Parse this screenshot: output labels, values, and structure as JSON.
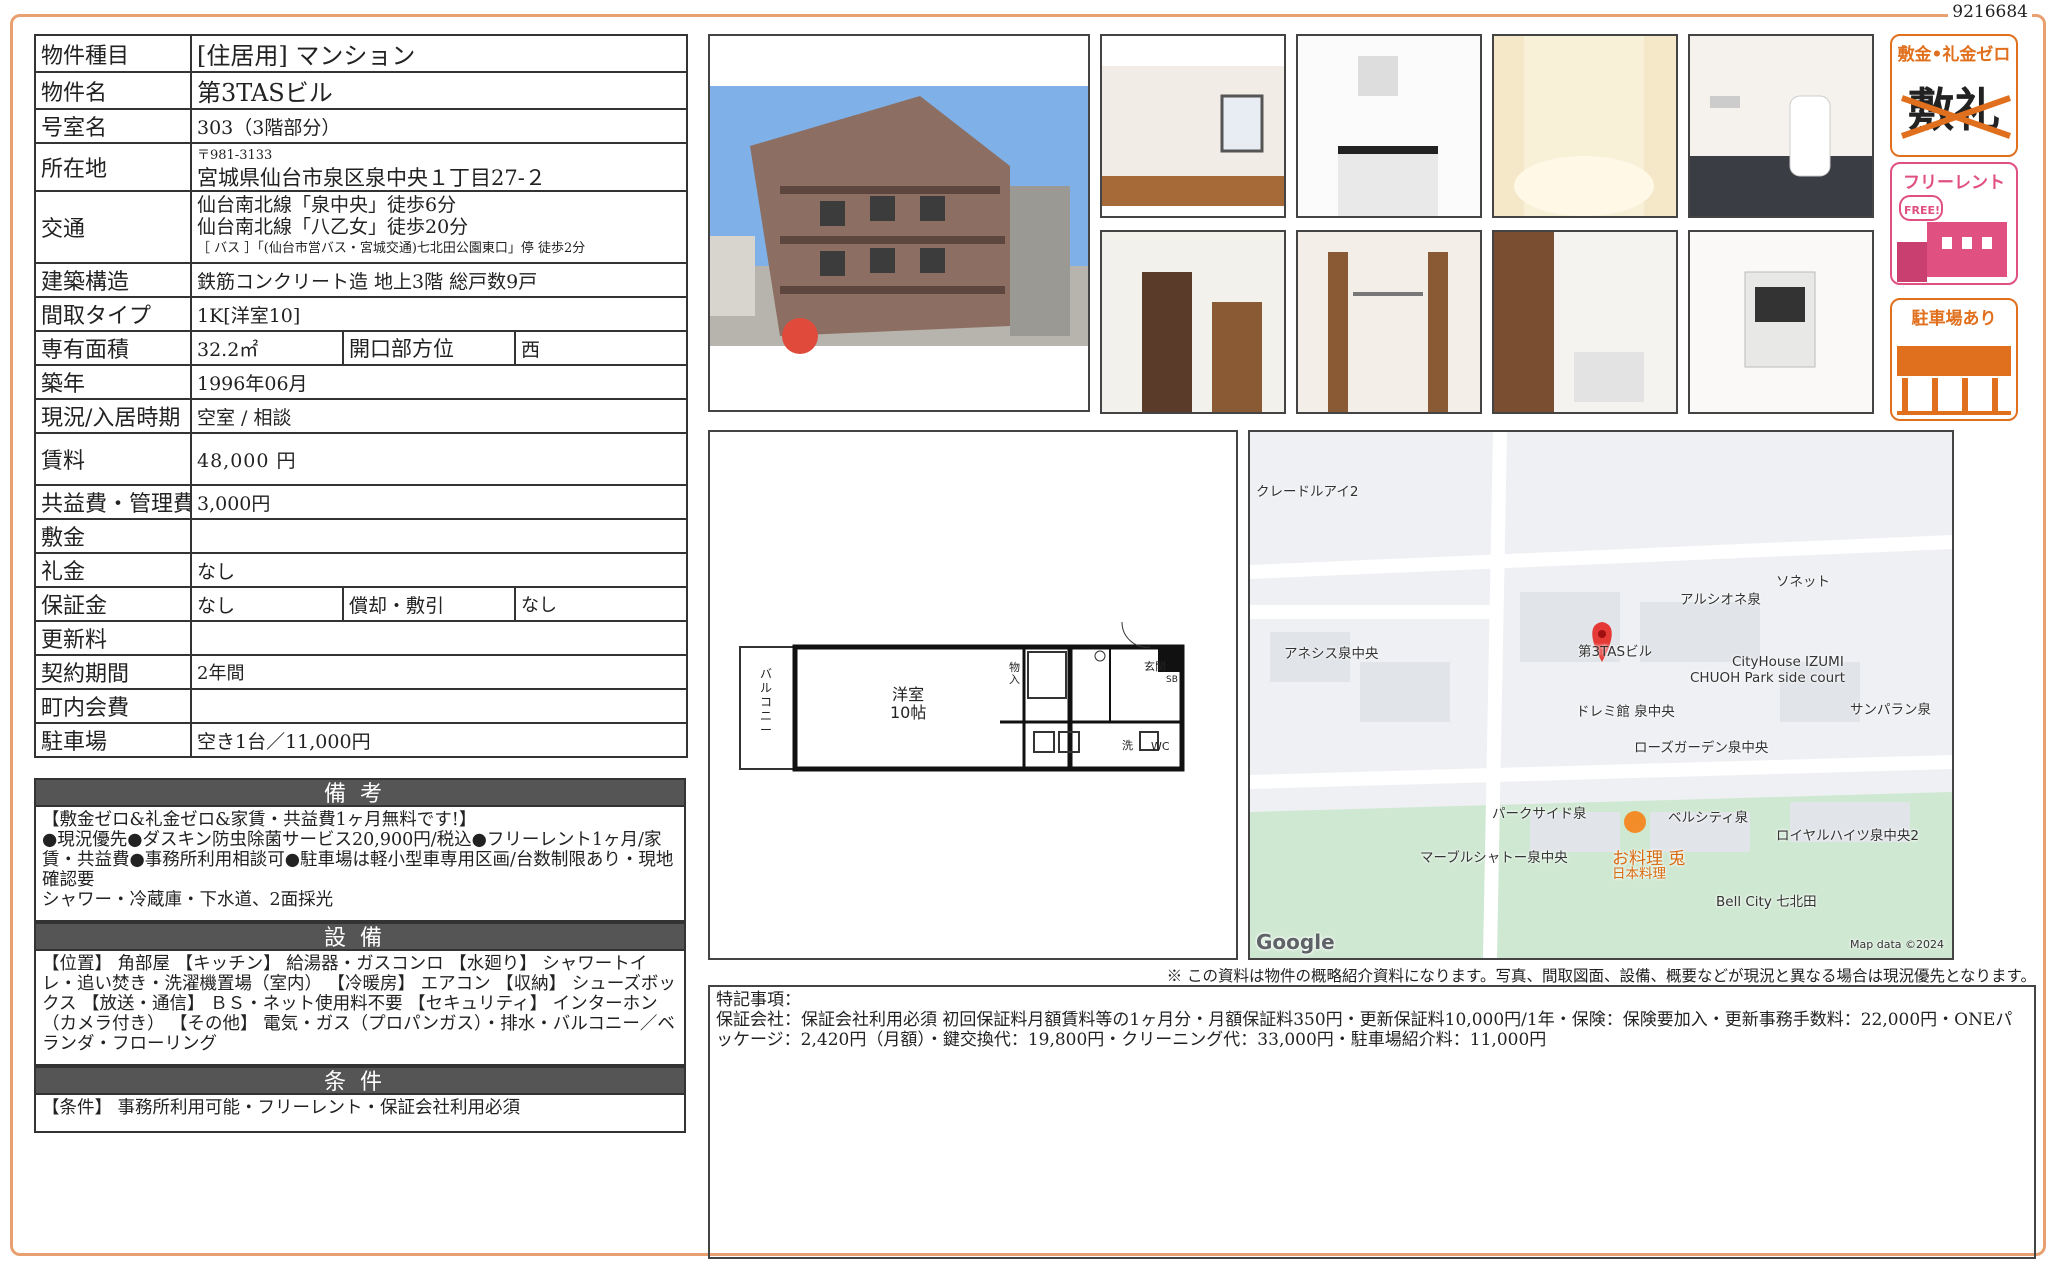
{
  "doc_id": "9216684",
  "info": {
    "type_label": "物件種目",
    "type_value": "[住居用]  マンション",
    "name_label": "物件名",
    "name_value": "第3TASビル",
    "room_label": "号室名",
    "room_value": "303（3階部分）",
    "address_label": "所在地",
    "postal": "〒981-3133",
    "address": "宮城県仙台市泉区泉中央１丁目27-２",
    "transport_label": "交通",
    "transport_1": "仙台南北線「泉中央」徒歩6分",
    "transport_2": "仙台南北線「八乙女」徒歩20分",
    "transport_3": "［ バス ］「(仙台市営バス・宮城交通)七北田公園東口」停 徒歩2分",
    "structure_label": "建築構造",
    "structure_value": "鉄筋コンクリート造 地上3階 総戸数9戸",
    "layout_label": "間取タイプ",
    "layout_value": "1K[洋室10]",
    "area_label": "専有面積",
    "area_value": "32.2㎡",
    "direction_label": "開口部方位",
    "direction_value": "西",
    "built_label": "築年",
    "built_value": "1996年06月",
    "status_label": "現況/入居時期",
    "status_value": "空室 / 相談",
    "rent_label": "賃料",
    "rent_value": "48,000 円",
    "fee_label": "共益費・管理費",
    "fee_value": "3,000円",
    "shikikin_label": "敷金",
    "shikikin_value": "",
    "reikin_label": "礼金",
    "reikin_value": "なし",
    "deposit_label": "保証金",
    "deposit_value": "なし",
    "amort_label": "償却・敷引",
    "amort_value": "なし",
    "renewal_label": "更新料",
    "renewal_value": "",
    "contract_label": "契約期間",
    "contract_value": "2年間",
    "town_label": "町内会費",
    "town_value": "",
    "parking_label": "駐車場",
    "parking_value": "空き1台／11,000円"
  },
  "remarks": {
    "title": "備考",
    "line1": "【敷金ゼロ&礼金ゼロ&家賃・共益費1ヶ月無料です!】",
    "line2": "●現況優先●ダスキン防虫除菌サービス20,900円/税込●フリーレント1ヶ月/家賃・共益費●事務所利用相談可●駐車場は軽小型車専用区画/台数制限あり・現地確認要",
    "line3": "シャワー・冷蔵庫・下水道、2面採光"
  },
  "equipment": {
    "title": "設備",
    "text": "【位置】 角部屋 【キッチン】 給湯器・ガスコンロ 【水廻り】 シャワートイレ・追い焚き・洗濯機置場（室内） 【冷暖房】 エアコン 【収納】 シューズボックス 【放送・通信】 ＢＳ・ネット使用料不要 【セキュリティ】 インターホン（カメラ付き） 【その他】 電気・ガス（プロパンガス）・排水・バルコニー／ベランダ・フローリング"
  },
  "conditions": {
    "title": "条件",
    "text": "【条件】 事務所利用可能・フリーレント・保証会社利用必須"
  },
  "badges": {
    "b1_title": "敷金•礼金ゼロ",
    "b1_glyph": "敷礼",
    "b2_title": "フリーレント",
    "b2_sub": "FREE!",
    "b3_title": "駐車場あり"
  },
  "floorplan": {
    "room": "洋室",
    "size": "10帖",
    "balcony": "バルコニー",
    "genkan": "玄関",
    "wc": "WC",
    "storage": "物入",
    "sb": "SB",
    "sen": "洗"
  },
  "map": {
    "labels": [
      "クレードルアイ2",
      "アルシオネ泉",
      "ソネット",
      "アネシス泉中央",
      "第3TASビル",
      "CityHouse IZUMI",
      "CHUOH Park side court",
      "ドレミ館 泉中央",
      "サンパラン泉",
      "ローズガーデン泉中央",
      "パークサイド泉",
      "ベルシティ泉",
      "ロイヤルハイツ泉中央2",
      "マーブルシャトー泉中央",
      "お料理 兎",
      "日本料理",
      "Bell City 七北田"
    ],
    "google": "Google",
    "mapdata": "Map data ©2024"
  },
  "note": "※ この資料は物件の概略紹介資料になります。写真、間取図面、設備、概要などが現況と異なる場合は現況優先となります。",
  "special": {
    "title": "特記事項：",
    "text": "保証会社：保証会社利用必須 初回保証料月額賃料等の1ヶ月分・月額保証料350円・更新保証料10,000円/1年・保険：保険要加入・更新事務手数料：22,000円・ONEパッケージ：2,420円（月額）・鍵交換代：19,800円・クリーニング代：33,000円・駐車場紹介料：11,000円"
  },
  "colors": {
    "frame": "#e8a070",
    "badge": "#e0701e",
    "badge_pink": "#e05080",
    "header": "#555555"
  }
}
